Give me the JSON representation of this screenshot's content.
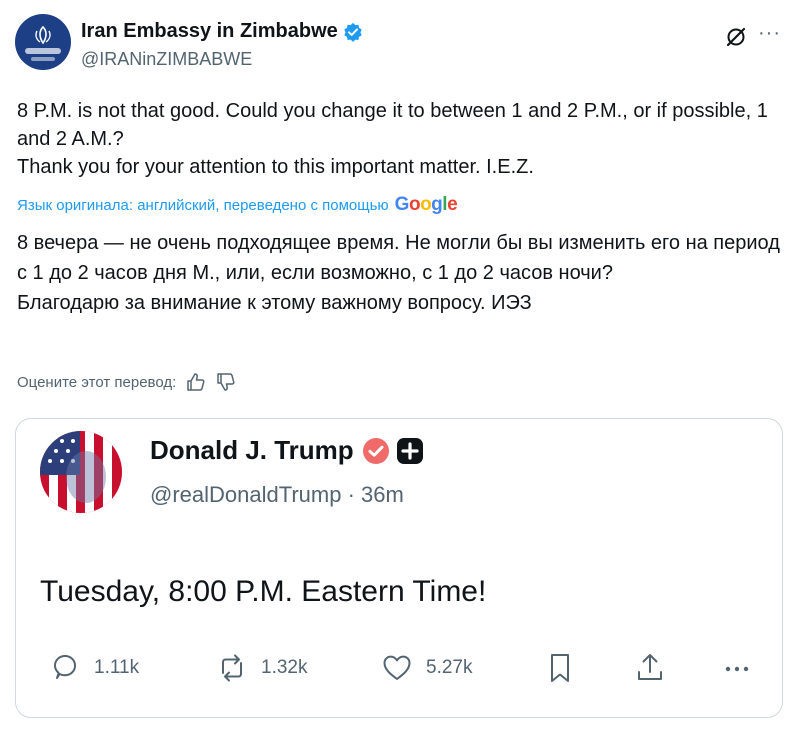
{
  "post": {
    "display_name": "Iran Embassy in Zimbabwe",
    "handle": "@IRANinZIMBABWE",
    "text_lines": [
      "8 P.M. is not that good. Could you change it to between 1 and 2 P.M., or if possible, 1 and 2 A.M.?",
      "Thank you for your attention to this important matter. I.E.Z."
    ],
    "translated_by": "Язык оригинала: английский, переведено с помощью",
    "translation_lines": [
      "8 вечера — не очень подходящее время. Не могли бы вы изменить его на период с 1 до 2 часов дня М., или, если возможно, с 1 до 2 часов ночи?",
      "Благодарю за внимание к этому важному вопросу. ИЭЗ"
    ],
    "rate_translation": "Оцените этот перевод:"
  },
  "quote": {
    "display_name": "Donald J. Trump",
    "handle": "@realDonaldTrump",
    "time": "· 36m",
    "text": "Tuesday, 8:00 P.M. Eastern Time!",
    "actions": {
      "replies": "1.11k",
      "reposts": "1.32k",
      "likes": "5.27k"
    }
  },
  "colors": {
    "accent": "#1d9bf0",
    "muted": "#536471",
    "border": "#cfd9de",
    "truth_badge": "#f06a6a"
  },
  "icons": [
    "verified-icon",
    "grok-icon",
    "more-icon",
    "thumbs-up-icon",
    "thumbs-down-icon",
    "reply-icon",
    "repost-icon",
    "like-icon",
    "bookmark-icon",
    "share-icon",
    "more-horizontal-icon"
  ]
}
